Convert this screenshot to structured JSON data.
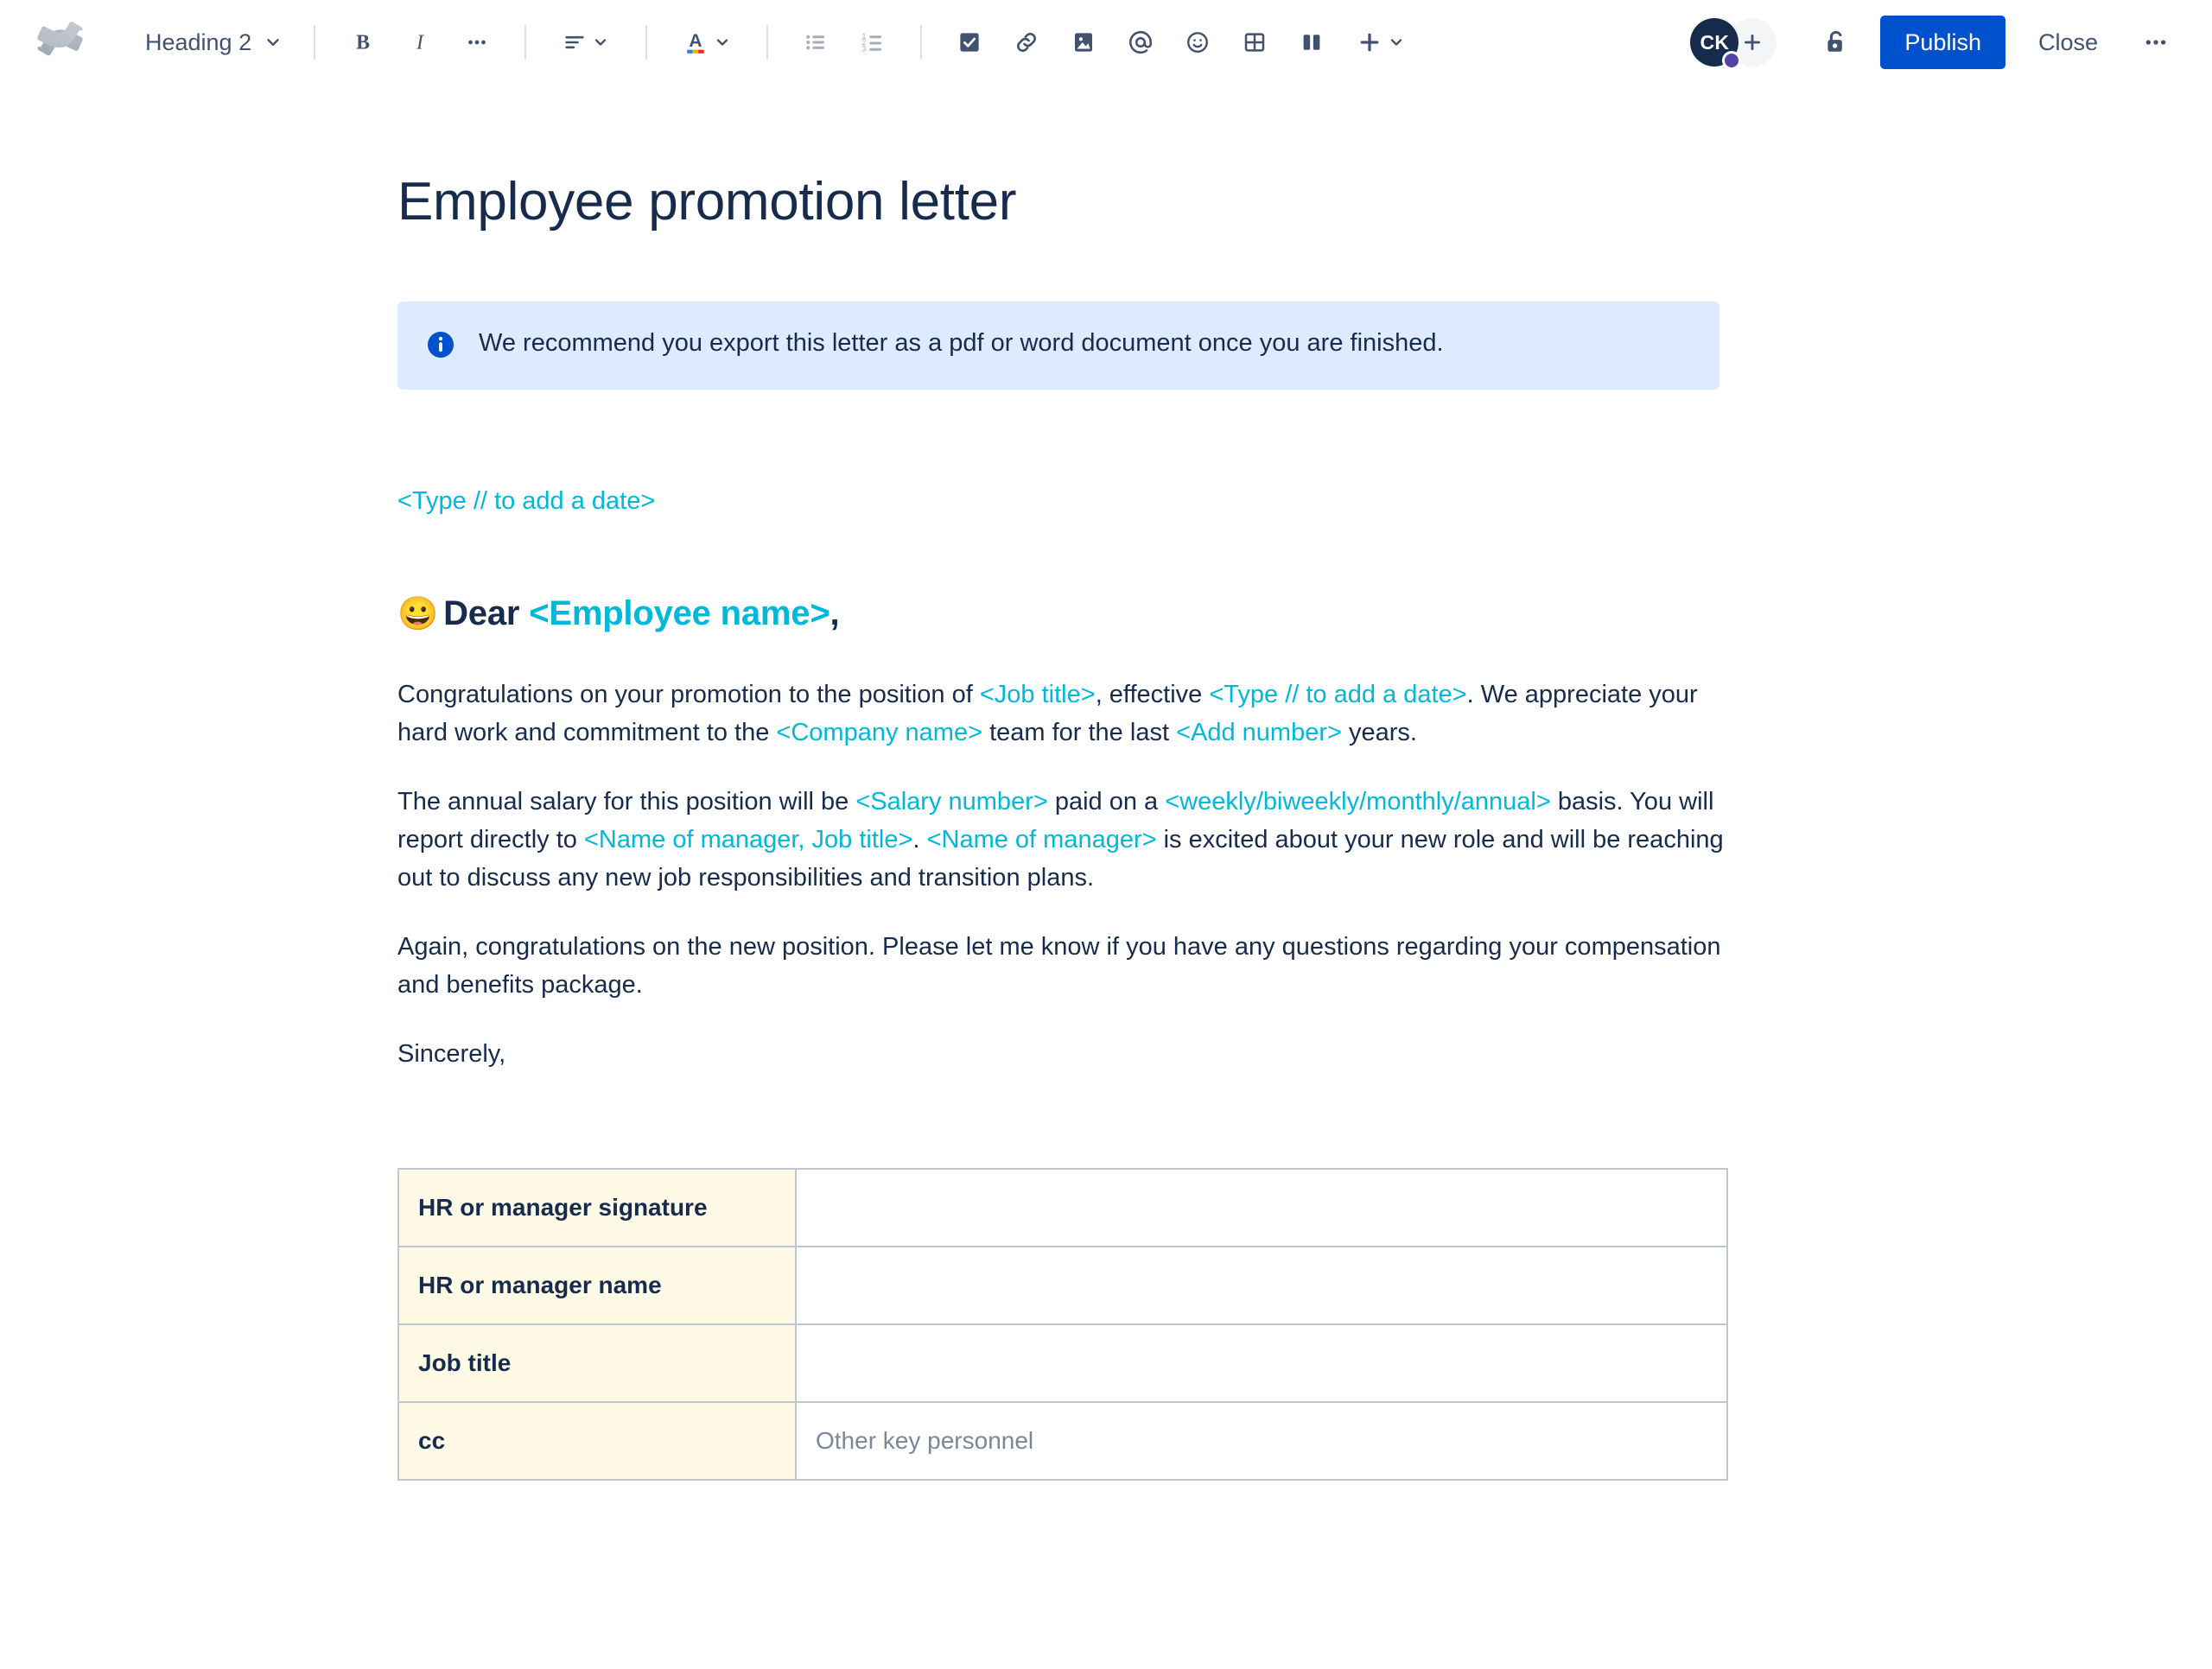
{
  "toolbar": {
    "logo_name": "confluence-logo",
    "block_style": "Heading 2",
    "buttons": [
      {
        "name": "bold",
        "label": "B"
      },
      {
        "name": "italic",
        "label": "I"
      },
      {
        "name": "more-formatting",
        "label": "…"
      },
      {
        "name": "text-align",
        "label": "Text alignment"
      },
      {
        "name": "text-color",
        "label": "Text color"
      },
      {
        "name": "bullet-list",
        "label": "Bulleted list"
      },
      {
        "name": "numbered-list",
        "label": "Numbered list"
      },
      {
        "name": "action-item",
        "label": "Action item"
      },
      {
        "name": "link",
        "label": "Link"
      },
      {
        "name": "image",
        "label": "Image"
      },
      {
        "name": "mention",
        "label": "Mention"
      },
      {
        "name": "emoji",
        "label": "Emoji"
      },
      {
        "name": "table",
        "label": "Table"
      },
      {
        "name": "layout",
        "label": "Layouts"
      },
      {
        "name": "insert-more",
        "label": "Insert more content"
      }
    ],
    "avatar_initials": "CK",
    "add_people_label": "+",
    "restrictions_label": "Restrictions",
    "publish_label": "Publish",
    "close_label": "Close",
    "more_actions_label": "•••",
    "accent_color": "#0052CC",
    "avatar_color": "#172B4D",
    "avatar_badge_color": "#5243AA"
  },
  "document": {
    "title": "Employee promotion letter",
    "info_panel": {
      "icon": "info-icon",
      "text": "We recommend you export this letter as a pdf or word document once you are finished.",
      "background": "#DEEBFF"
    },
    "placeholder_color": "#00B8D9",
    "date_line": "<Type // to add a date>",
    "salutation": {
      "emoji": "😀",
      "static_prefix": "Dear ",
      "placeholder": "<Employee name>",
      "suffix": ","
    },
    "paragraphs": [
      {
        "name": "paragraph-congratulations",
        "parts": [
          {
            "t": "Congratulations on your promotion to the position of ",
            "ph": false
          },
          {
            "t": "<Job title>",
            "ph": true
          },
          {
            "t": ", effective ",
            "ph": false
          },
          {
            "t": "<Type // to add a date>",
            "ph": true
          },
          {
            "t": ". We appreciate your hard work and commitment to the ",
            "ph": false
          },
          {
            "t": "<Company name>",
            "ph": true
          },
          {
            "t": " team for the last ",
            "ph": false
          },
          {
            "t": "<Add number>",
            "ph": true
          },
          {
            "t": " years.",
            "ph": false
          }
        ]
      },
      {
        "name": "paragraph-salary",
        "parts": [
          {
            "t": "The annual salary for this position will be ",
            "ph": false
          },
          {
            "t": "<Salary number>",
            "ph": true
          },
          {
            "t": " paid on a ",
            "ph": false
          },
          {
            "t": "<weekly/biweekly/monthly/annual>",
            "ph": true
          },
          {
            "t": " basis. You will report directly to ",
            "ph": false
          },
          {
            "t": "<Name of manager, Job title>",
            "ph": true
          },
          {
            "t": ". ",
            "ph": false
          },
          {
            "t": "<Name of manager>",
            "ph": true
          },
          {
            "t": " is excited about your new role and will be reaching out to discuss any new job responsibilities and transition plans.",
            "ph": false
          }
        ]
      },
      {
        "name": "paragraph-closing",
        "parts": [
          {
            "t": "Again, congratulations on the new position. Please let me know if you have any questions regarding your compensation and benefits package.",
            "ph": false
          }
        ]
      },
      {
        "name": "paragraph-sincerely",
        "parts": [
          {
            "t": "Sincerely,",
            "ph": false
          }
        ]
      }
    ],
    "signature_table": {
      "header_background": "#FFFAE6",
      "border_color": "#C1C7D0",
      "rows": [
        {
          "label": "HR or manager signature",
          "value": "",
          "placeholder": ""
        },
        {
          "label": "HR or manager name",
          "value": "",
          "placeholder": ""
        },
        {
          "label": "Job title",
          "value": "",
          "placeholder": ""
        },
        {
          "label": "cc",
          "value": "",
          "placeholder": "Other key personnel"
        }
      ]
    }
  }
}
